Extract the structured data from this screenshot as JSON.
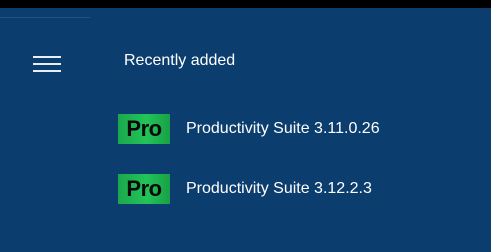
{
  "start_menu": {
    "menu_icon": "hamburger-menu-icon",
    "section_title": "Recently added",
    "apps": [
      {
        "icon_text": "Pro",
        "name": "Productivity Suite 3.11.0.26"
      },
      {
        "icon_text": "Pro",
        "name": "Productivity Suite 3.12.2.3"
      }
    ]
  },
  "colors": {
    "background": "#0b3d6e",
    "tile_green": "#22c45a",
    "text": "#ffffff"
  }
}
